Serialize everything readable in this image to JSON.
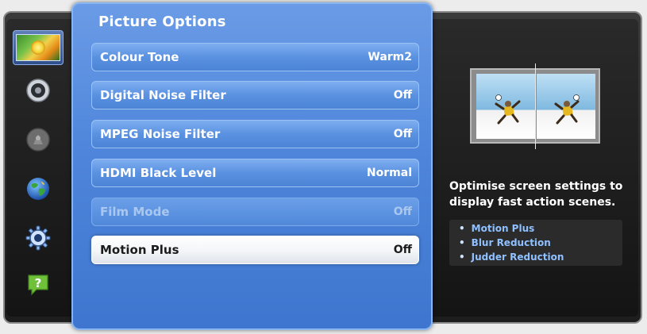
{
  "panel": {
    "title": "Picture Options",
    "options": [
      {
        "label": "Colour Tone",
        "value": "Warm2",
        "state": "normal"
      },
      {
        "label": "Digital Noise Filter",
        "value": "Off",
        "state": "normal"
      },
      {
        "label": "MPEG Noise Filter",
        "value": "Off",
        "state": "normal"
      },
      {
        "label": "HDMI Black Level",
        "value": "Normal",
        "state": "normal"
      },
      {
        "label": "Film Mode",
        "value": "Off",
        "state": "disabled"
      },
      {
        "label": "Motion Plus",
        "value": "Off",
        "state": "selected"
      }
    ]
  },
  "sidebar": {
    "items": [
      {
        "icon": "picture-icon",
        "active": true
      },
      {
        "icon": "sound-icon",
        "active": false
      },
      {
        "icon": "broadcast-icon",
        "active": false
      },
      {
        "icon": "network-globe-icon",
        "active": false
      },
      {
        "icon": "system-gear-icon",
        "active": false
      },
      {
        "icon": "support-help-icon",
        "active": false
      }
    ]
  },
  "info": {
    "description": "Optimise screen settings to display fast action scenes.",
    "bullets": [
      "Motion Plus",
      "Blur Reduction",
      "Judder Reduction"
    ]
  },
  "colors": {
    "panel_blue": "#4f86db",
    "selected_row": "#ffffff",
    "bullet_text": "#8fc0ff",
    "frame": "#1d1d1d"
  }
}
